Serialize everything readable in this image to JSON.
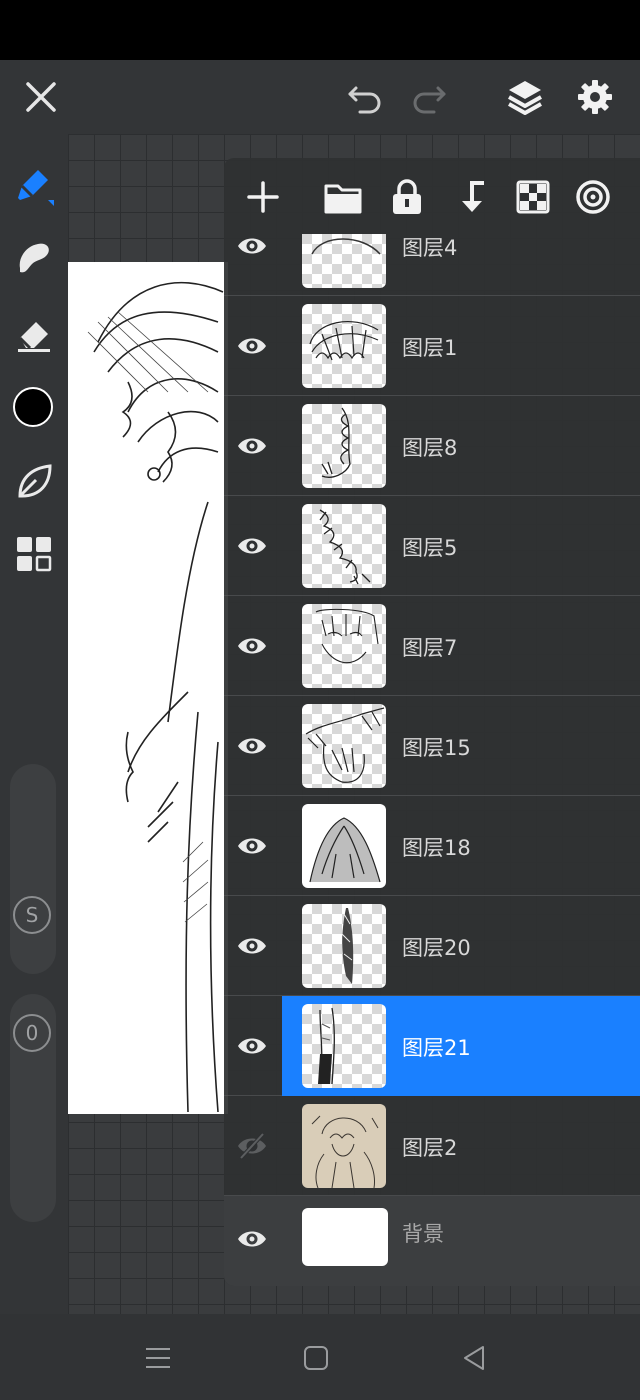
{
  "top_bar": {
    "close_icon": "close-icon",
    "undo_icon": "undo-icon",
    "redo_icon": "redo-icon",
    "layers_icon": "layers-icon",
    "settings_icon": "gear-icon"
  },
  "left_toolbar": {
    "tools": [
      "brush-icon",
      "smudge-icon",
      "eraser-icon",
      "color-swatch",
      "leaf-icon",
      "grid-icon"
    ],
    "current_color": "#000000",
    "size_label": "S",
    "opacity_label": "0",
    "accent_color": "#1a80ff"
  },
  "layer_panel": {
    "toolbar_icons": [
      "add-icon",
      "folder-icon",
      "lock-icon",
      "merge-down-icon",
      "checkerboard-icon",
      "blend-mode-icon"
    ],
    "layers": [
      {
        "name": "图层4",
        "visible": true,
        "selected": false
      },
      {
        "name": "图层1",
        "visible": true,
        "selected": false
      },
      {
        "name": "图层8",
        "visible": true,
        "selected": false
      },
      {
        "name": "图层5",
        "visible": true,
        "selected": false
      },
      {
        "name": "图层7",
        "visible": true,
        "selected": false
      },
      {
        "name": "图层15",
        "visible": true,
        "selected": false
      },
      {
        "name": "图层18",
        "visible": true,
        "selected": false
      },
      {
        "name": "图层20",
        "visible": true,
        "selected": false
      },
      {
        "name": "图层21",
        "visible": true,
        "selected": true
      },
      {
        "name": "图层2",
        "visible": false,
        "selected": false
      }
    ],
    "background_layer": {
      "name": "背景",
      "visible": true
    }
  },
  "nav_bar": {
    "menu_icon": "menu-icon",
    "home_icon": "home-icon",
    "back_icon": "back-icon"
  }
}
